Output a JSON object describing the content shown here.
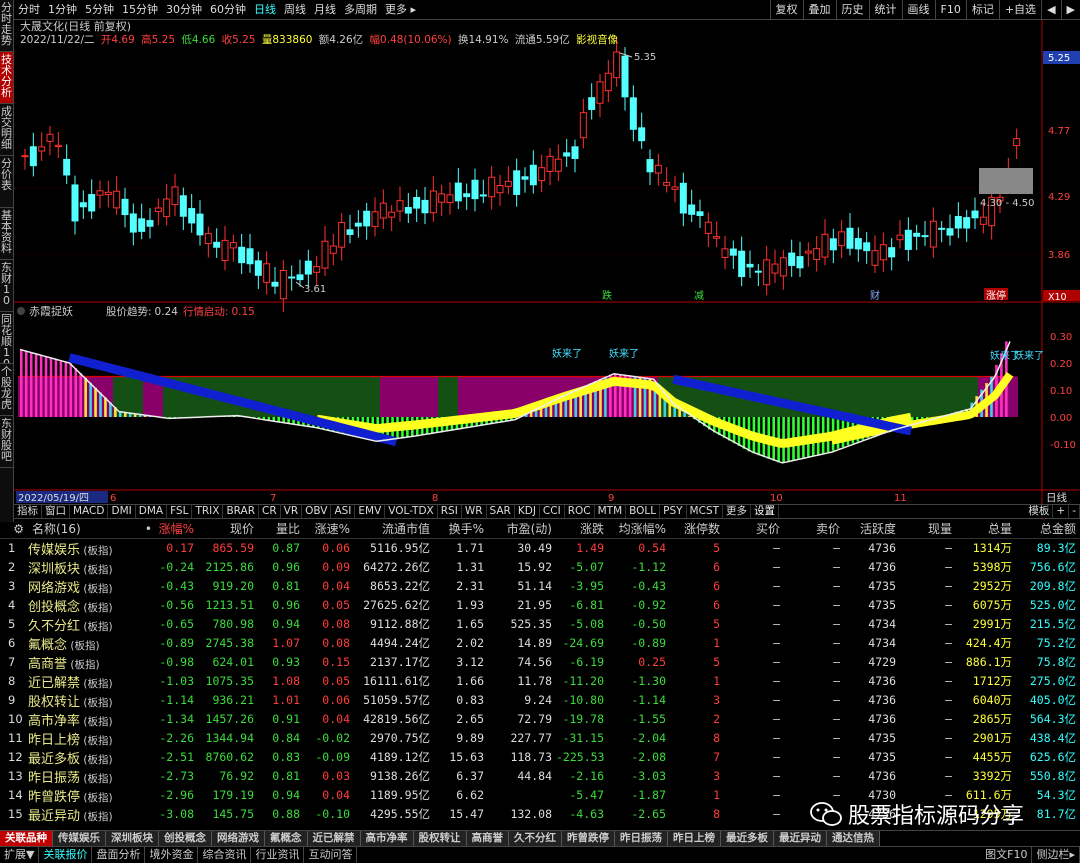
{
  "left_sidebar": [
    "分时走势",
    "技术分析",
    "成交明细",
    "分价表",
    "基本资料",
    "东财10",
    "同花顺10",
    "个股龙虎",
    "东财股吧"
  ],
  "toolbar": {
    "items": [
      "分时",
      "1分钟",
      "5分钟",
      "15分钟",
      "30分钟",
      "60分钟",
      "日线",
      "周线",
      "月线",
      "多周期",
      "更多 ▸"
    ],
    "active": "日线",
    "right": [
      "复权",
      "叠加",
      "历史",
      "统计",
      "画线",
      "F10",
      "标记",
      "+自选",
      "◀",
      "▶"
    ]
  },
  "info_bar": {
    "stock_name": "大晟文化(日线 前复权)",
    "date": "2022/11/22/二",
    "open": "开4.69",
    "high": "高5.25",
    "low": "低4.66",
    "close": "收5.25",
    "volume": "量833860",
    "amount": "额4.26亿",
    "change": "幅0.48(10.06%)",
    "turnover": "换14.91%",
    "float_cap": "流通5.59亿",
    "media": "影视音像"
  },
  "price_axis": {
    "ticks": [
      "5.25",
      "4.77",
      "4.29",
      "3.86"
    ],
    "current": "5.25",
    "box_label": "4.30 - 4.50"
  },
  "annotations": {
    "high": "5.35",
    "low": "3.61",
    "markers": [
      "跌",
      "减",
      "财",
      "涨停"
    ],
    "x10": "X10"
  },
  "indicator": {
    "name": "赤霞捉妖",
    "trend_label": "股价趋势:",
    "trend_value": "0.24",
    "start_label": "行情启动:",
    "start_value": "0.15",
    "axis_ticks": [
      "0.30",
      "0.20",
      "0.10",
      "0.00",
      "-0.10"
    ],
    "signal_text": "妖来了"
  },
  "date_axis": {
    "start": "2022/05/19/四",
    "months": [
      "6",
      "7",
      "8",
      "9",
      "10",
      "11"
    ],
    "right_label": "日线"
  },
  "chart_tabs": {
    "items": [
      "指标",
      "窗口",
      "MACD",
      "DMI",
      "DMA",
      "FSL",
      "TRIX",
      "BRAR",
      "CR",
      "VR",
      "OBV",
      "ASI",
      "EMV",
      "VOL-TDX",
      "RSI",
      "WR",
      "SAR",
      "KDJ",
      "CCI",
      "ROC",
      "MTM",
      "BOLL",
      "PSY",
      "MCST",
      "更多",
      "设置"
    ],
    "right": [
      "模板",
      "+",
      "-"
    ]
  },
  "table": {
    "headers": [
      "",
      "名称(16)",
      "•",
      "涨幅%",
      "现价",
      "量比",
      "涨速%",
      "流通市值",
      "换手%",
      "市盈(动)",
      "涨跌",
      "均涨幅%",
      "涨停数",
      "买价",
      "卖价",
      "活跃度",
      "现量",
      "总量",
      "总金额"
    ],
    "rows": [
      [
        "1",
        "传媒娱乐",
        "0.17",
        "865.59",
        "0.87",
        "0.06",
        "5116.95亿",
        "1.71",
        "30.49",
        "1.49",
        "0.54",
        "5",
        "4736",
        "1314万",
        "89.3亿"
      ],
      [
        "2",
        "深圳板块",
        "-0.24",
        "2125.86",
        "0.96",
        "0.09",
        "64272.26亿",
        "1.31",
        "15.92",
        "-5.07",
        "-1.12",
        "6",
        "4736",
        "5398万",
        "756.6亿"
      ],
      [
        "3",
        "网络游戏",
        "-0.43",
        "919.20",
        "0.81",
        "0.04",
        "8653.22亿",
        "2.31",
        "51.14",
        "-3.95",
        "-0.43",
        "6",
        "4735",
        "2952万",
        "209.8亿"
      ],
      [
        "4",
        "创投概念",
        "-0.56",
        "1213.51",
        "0.96",
        "0.05",
        "27625.62亿",
        "1.93",
        "21.95",
        "-6.81",
        "-0.92",
        "6",
        "4735",
        "6075万",
        "525.0亿"
      ],
      [
        "5",
        "久不分红",
        "-0.65",
        "780.98",
        "0.94",
        "0.08",
        "9112.88亿",
        "1.65",
        "525.35",
        "-5.08",
        "-0.50",
        "5",
        "4734",
        "2991万",
        "215.5亿"
      ],
      [
        "6",
        "氟概念",
        "-0.89",
        "2745.38",
        "1.07",
        "0.08",
        "4494.24亿",
        "2.02",
        "14.89",
        "-24.69",
        "-0.89",
        "1",
        "4734",
        "424.4万",
        "75.2亿"
      ],
      [
        "7",
        "高商誉",
        "-0.98",
        "624.01",
        "0.93",
        "0.15",
        "2137.17亿",
        "3.12",
        "74.56",
        "-6.19",
        "0.25",
        "5",
        "4729",
        "886.1万",
        "75.8亿"
      ],
      [
        "8",
        "近已解禁",
        "-1.03",
        "1075.35",
        "1.08",
        "0.05",
        "16111.61亿",
        "1.66",
        "11.78",
        "-11.20",
        "-1.30",
        "1",
        "4736",
        "1712万",
        "275.0亿"
      ],
      [
        "9",
        "股权转让",
        "-1.14",
        "936.21",
        "1.01",
        "0.06",
        "51059.57亿",
        "0.83",
        "9.24",
        "-10.80",
        "-1.14",
        "3",
        "4736",
        "6040万",
        "405.0亿"
      ],
      [
        "10",
        "高市净率",
        "-1.34",
        "1457.26",
        "0.91",
        "0.04",
        "42819.56亿",
        "2.65",
        "72.79",
        "-19.78",
        "-1.55",
        "2",
        "4736",
        "2865万",
        "564.3亿"
      ],
      [
        "11",
        "昨日上榜",
        "-2.26",
        "1344.94",
        "0.84",
        "-0.02",
        "2970.75亿",
        "9.89",
        "227.77",
        "-31.15",
        "-2.04",
        "8",
        "4735",
        "2901万",
        "438.4亿"
      ],
      [
        "12",
        "最近多板",
        "-2.51",
        "8760.62",
        "0.83",
        "-0.09",
        "4189.12亿",
        "15.63",
        "118.73",
        "-225.53",
        "-2.08",
        "7",
        "4735",
        "4455万",
        "625.6亿"
      ],
      [
        "13",
        "昨日振荡",
        "-2.73",
        "76.92",
        "0.81",
        "0.03",
        "9138.26亿",
        "6.37",
        "44.84",
        "-2.16",
        "-3.03",
        "3",
        "4736",
        "3392万",
        "550.8亿"
      ],
      [
        "14",
        "昨曾跌停",
        "-2.96",
        "179.19",
        "0.94",
        "0.04",
        "1189.95亿",
        "6.62",
        "",
        "-5.47",
        "-1.87",
        "1",
        "4730",
        "611.6万",
        "54.3亿"
      ],
      [
        "15",
        "最近异动",
        "-3.08",
        "145.75",
        "0.88",
        "-0.10",
        "4295.55亿",
        "15.47",
        "132.08",
        "-4.63",
        "-2.65",
        "8",
        "4736",
        "1295万",
        "81.7亿"
      ]
    ],
    "suffix": "(板指)",
    "dash": "—"
  },
  "bottom_tabs": [
    "关联品种",
    "传媒娱乐",
    "深圳板块",
    "创投概念",
    "网络游戏",
    "氟概念",
    "近已解禁",
    "高市净率",
    "股权转让",
    "高商誉",
    "久不分红",
    "昨曾跌停",
    "昨日振荡",
    "昨日上榜",
    "最近多板",
    "最近异动",
    "通达信热"
  ],
  "status_bar": {
    "items": [
      "扩展▼",
      "关联报价",
      "盘面分析",
      "境外资金",
      "综合资讯",
      "行业资讯",
      "互动问答"
    ],
    "active": "关联报价",
    "right": [
      "图文F10",
      "侧边栏▸"
    ]
  },
  "watermark": "股票指标源码分享"
}
